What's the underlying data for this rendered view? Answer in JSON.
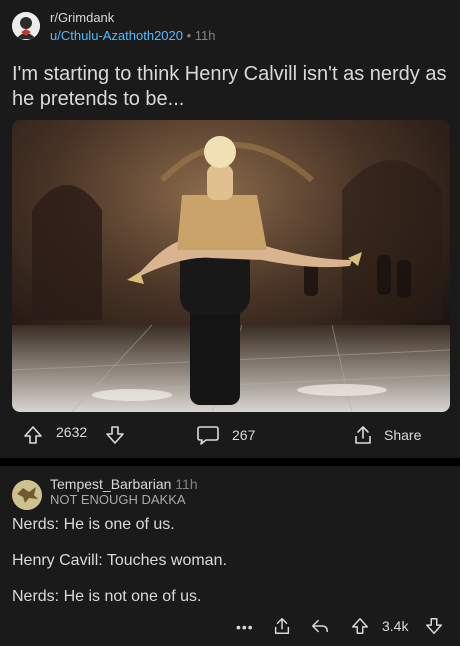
{
  "post": {
    "subreddit": "r/Grimdank",
    "author": "u/Cthulu-Azathoth2020",
    "separator": "•",
    "age": "11h",
    "title": "I'm starting to think Henry Calvill isn't as nerdy as he pretends to be...",
    "image_icon": "photo-dance-lift",
    "upvotes": "2632",
    "comments": "267",
    "share_label": "Share"
  },
  "comment": {
    "author": "Tempest_Barbarian",
    "age": "11h",
    "flair": "NOT ENOUGH DAKKA",
    "lines": [
      "Nerds: He is one of us.",
      "Henry Cavill: Touches woman.",
      "Nerds: He is not one of us."
    ],
    "more": "•••",
    "score": "3.4k"
  },
  "colors": {
    "background": "#000000",
    "card": "#1a1a1b",
    "text": "#d7dadc",
    "username_link": "#4fbcff",
    "muted": "#818384"
  }
}
